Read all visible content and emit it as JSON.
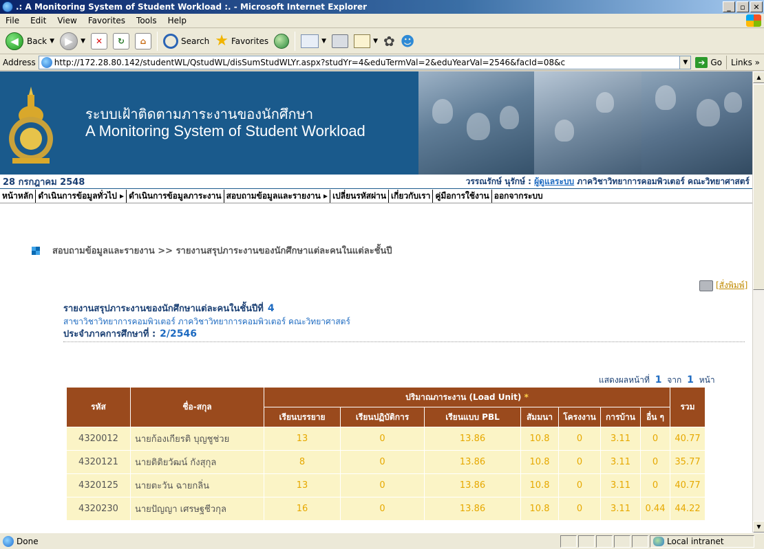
{
  "window": {
    "title": ".: A Monitoring System of Student Workload :. - Microsoft Internet Explorer",
    "controls": [
      "_",
      "▫",
      "✕"
    ]
  },
  "menu": [
    "File",
    "Edit",
    "View",
    "Favorites",
    "Tools",
    "Help"
  ],
  "toolbar": {
    "back_label": "Back",
    "search_label": "Search",
    "favorites_label": "Favorites"
  },
  "address": {
    "label": "Address",
    "url": "http://172.28.80.142/studentWL/QstudWL/disSumStudWLYr.aspx?studYr=4&eduTermVal=2&eduYearVal=2546&facId=08&c",
    "go_label": "Go",
    "links_label": "Links"
  },
  "banner": {
    "title_th": "ระบบเฝ้าติดตามภาระงานของนักศึกษา",
    "title_en": "A Monitoring System of Student Workload"
  },
  "info": {
    "date": "28 กรกฎาคม 2548",
    "user_name": "วรรณรักษ์ นุรักษ์",
    "user_role": "ผู้ดูแลระบบ",
    "user_dept": "ภาควิชาวิทยาการคอมพิวเตอร์ คณะวิทยาศาสตร์"
  },
  "nav": [
    "หน้าหลัก",
    "ดำเนินการข้อมูลทั่วไป ▸",
    "ดำเนินการข้อมูลภาระงาน",
    "สอบถามข้อมูลและรายงาน ▸",
    "เปลี่ยนรหัสผ่าน",
    "เกี่ยวกับเรา",
    "คู่มือการใช้งาน",
    "ออกจากระบบ"
  ],
  "breadcrumb": "สอบถามข้อมูลและรายงาน >> รายงานสรุปภาระงานของนักศึกษาแต่ละคนในแต่ละชั้นปี",
  "print_label": "[สั่งพิมพ์]",
  "report": {
    "heading_label": "รายงานสรุปภาระงานของนักศึกษาแต่ละคนในชั้นปีที่",
    "year_value": "4",
    "program": "สาขาวิชาวิทยาการคอมพิวเตอร์   ภาควิชาวิทยาการคอมพิวเตอร์  คณะวิทยาศาสตร์",
    "term_label": "ประจำภาคการศึกษาที่ :",
    "term_value": "2/2546"
  },
  "paging": {
    "prefix": "แสดงผลหน้าที่",
    "current": "1",
    "of": "จาก",
    "total": "1",
    "suffix": "หน้า"
  },
  "table": {
    "col_id": "รหัส",
    "col_name": "ชื่อ-สกุล",
    "col_group": "ปริมาณภาระงาน (Load Unit)",
    "col_group_mark": "*",
    "col_total": "รวม",
    "sub_cols": [
      "เรียนบรรยาย",
      "เรียนปฏิบัติการ",
      "เรียนแบบ PBL",
      "สัมมนา",
      "โครงงาน",
      "การบ้าน",
      "อื่น ๆ"
    ],
    "rows": [
      {
        "id": "4320012",
        "name": "นายก้องเกียรติ บุญชูช่วย",
        "vals": [
          "13",
          "0",
          "13.86",
          "10.8",
          "0",
          "3.11",
          "0"
        ],
        "total": "40.77"
      },
      {
        "id": "4320121",
        "name": "นายติติยวัฒน์ กังสุกุล",
        "vals": [
          "8",
          "0",
          "13.86",
          "10.8",
          "0",
          "3.11",
          "0"
        ],
        "total": "35.77"
      },
      {
        "id": "4320125",
        "name": "นายตะวัน ฉายกลิ่น",
        "vals": [
          "13",
          "0",
          "13.86",
          "10.8",
          "0",
          "3.11",
          "0"
        ],
        "total": "40.77"
      },
      {
        "id": "4320230",
        "name": "นายปัญญา เศรษฐชีวกุล",
        "vals": [
          "16",
          "0",
          "13.86",
          "10.8",
          "0",
          "3.11",
          "0.44"
        ],
        "total": "44.22"
      }
    ]
  },
  "status": {
    "text": "Done",
    "zone": "Local intranet"
  },
  "colors": {
    "banner": "#1a5a8c",
    "table_header": "#9a4a1d",
    "table_row": "#fbf4c6",
    "value_text": "#e6a800"
  }
}
